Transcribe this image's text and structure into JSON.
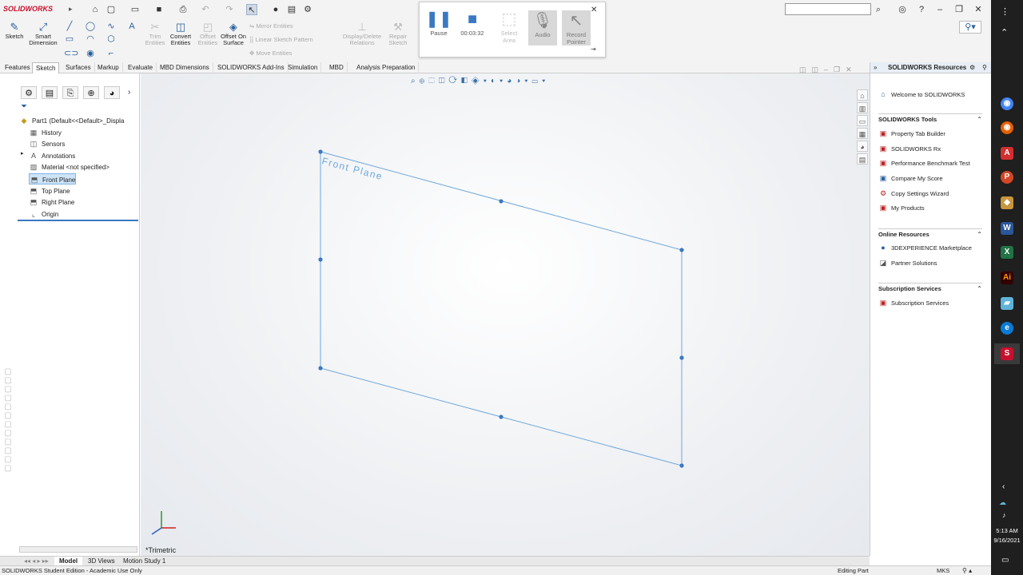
{
  "titlebar": {
    "app_logo": "SOLIDWORKS",
    "search_placeholder": "",
    "icons": [
      "home-icon",
      "new-document-icon",
      "open-icon",
      "save-icon",
      "print-icon",
      "undo-icon",
      "redo-icon",
      "select-icon",
      "rebuild-icon",
      "file-properties-icon",
      "options-icon"
    ]
  },
  "command_manager": {
    "sketch": "Sketch",
    "smart_dimension": "Smart Dimension",
    "trim_entities": "Trim Entities",
    "convert_entities": "Convert Entities",
    "offset_entities": "Offset Entities",
    "offset_on_surface": "Offset On Surface",
    "mirror_entities": "Mirror Entities",
    "linear_sketch_pattern": "Linear Sketch Pattern",
    "move_entities": "Move Entities",
    "display_delete_relations": "Display/Delete Relations",
    "repair_sketch": "Repair Sketch"
  },
  "recorder": {
    "pause": "Pause",
    "timer": "00:03:32",
    "select_area": "Select Area",
    "audio": "Audio",
    "record_pointer": "Record Pointer"
  },
  "tabs": [
    "Features",
    "Sketch",
    "Surfaces",
    "Markup",
    "Evaluate",
    "MBD Dimensions",
    "SOLIDWORKS Add-Ins",
    "Simulation",
    "MBD",
    "Analysis Preparation"
  ],
  "feature_tree": {
    "part": "Part1  (Default<<Default>_Displa",
    "items": [
      {
        "label": "History",
        "icon": "history-icon"
      },
      {
        "label": "Sensors",
        "icon": "sensors-icon"
      },
      {
        "label": "Annotations",
        "icon": "annotations-icon"
      },
      {
        "label": "Material <not specified>",
        "icon": "material-icon"
      },
      {
        "label": "Front Plane",
        "icon": "plane-icon"
      },
      {
        "label": "Top Plane",
        "icon": "plane-icon"
      },
      {
        "label": "Right Plane",
        "icon": "plane-icon"
      },
      {
        "label": "Origin",
        "icon": "origin-icon"
      }
    ]
  },
  "viewport": {
    "plane_label": "Front Plane",
    "view_name": "*Trimetric"
  },
  "task_pane": {
    "title": "SOLIDWORKS Resources",
    "welcome": "Welcome to SOLIDWORKS",
    "sections": [
      {
        "title": "SOLIDWORKS Tools",
        "items": [
          "Property Tab Builder",
          "SOLIDWORKS Rx",
          "Performance Benchmark Test",
          "Compare My Score",
          "Copy Settings Wizard",
          "My Products"
        ]
      },
      {
        "title": "Online Resources",
        "items": [
          "3DEXPERIENCE Marketplace",
          "Partner Solutions"
        ]
      },
      {
        "title": "Subscription Services",
        "items": [
          "Subscription Services"
        ]
      }
    ]
  },
  "bottom_tabs": [
    "Model",
    "3D Views",
    "Motion Study 1"
  ],
  "status": {
    "edition": "SOLIDWORKS Student Edition - Academic Use Only",
    "mode": "Editing Part",
    "units": "MKS"
  },
  "clock": {
    "time": "5:13 AM",
    "date": "9/16/2021"
  }
}
